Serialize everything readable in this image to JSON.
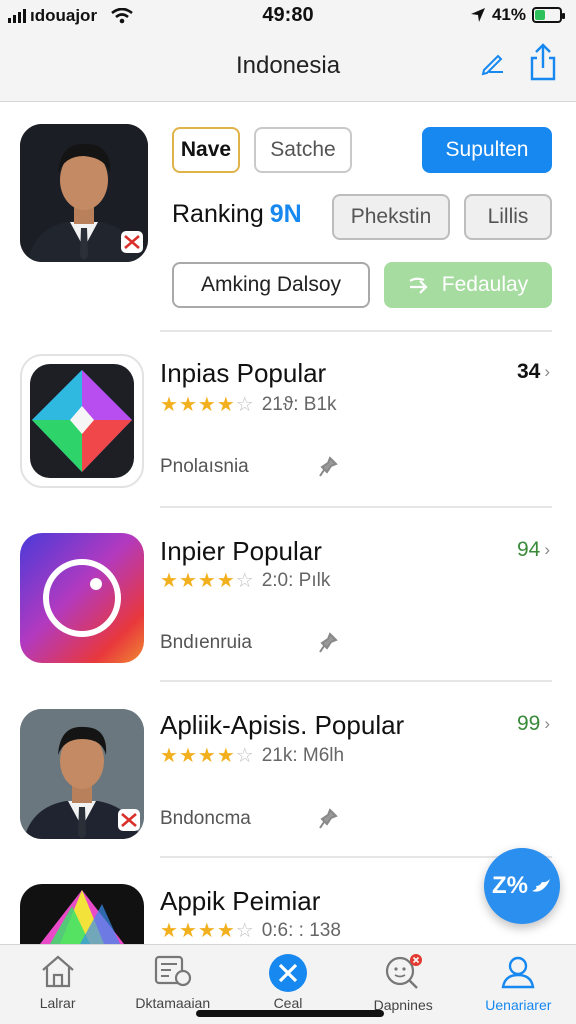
{
  "status_bar": {
    "carrier": "ıdouajor",
    "time": "49:80",
    "battery_percent": "41%",
    "battery_level": 0.41
  },
  "nav": {
    "title": "Indonesia",
    "edit_icon": "pencil-icon",
    "share_icon": "share-icon"
  },
  "header": {
    "chips": {
      "nave": "Nave",
      "satche": "Satche",
      "supulten": "Supulten"
    },
    "ranking_label": "Ranking",
    "ranking_value": "9N",
    "buttons": {
      "phekstin": "Phekstin",
      "lillis": "Lillis",
      "amking": "Amking Dalsoy",
      "fedaulay": "Fedaulay"
    }
  },
  "apps": [
    {
      "title": "Inpias Popular",
      "rating": 4.5,
      "meta": "21ϑ: Β1k",
      "subtitle": "Pnolaısnia",
      "count": "34",
      "count_color": "#111111"
    },
    {
      "title": "Inpier Popular",
      "rating": 4.5,
      "meta": "2:0: Pılk",
      "subtitle": "Bndıenruia",
      "count": "94",
      "count_color": "#3a8a3a"
    },
    {
      "title": "Apliik-Apisis. Popular",
      "rating": 4.5,
      "meta": "21k: M6lh",
      "subtitle": "Bndoncma",
      "count": "99",
      "count_color": "#3a8a3a"
    },
    {
      "title": "Appik Peimiar",
      "rating": 4.5,
      "meta": "0:6: : 138",
      "subtitle": "",
      "count": "",
      "count_color": "#111111"
    }
  ],
  "fab": {
    "label": "Z%"
  },
  "tabs": [
    {
      "label": "Lalrar",
      "icon": "home-icon"
    },
    {
      "label": "Dktamaaian",
      "icon": "gallery-icon"
    },
    {
      "label": "Ceal",
      "icon": "close-circle-icon"
    },
    {
      "label": "Dapnines",
      "icon": "search-face-icon"
    },
    {
      "label": "Uenariarer",
      "icon": "profile-icon"
    }
  ],
  "colors": {
    "accent": "#1688f0",
    "star": "#f2b01e",
    "green_button": "#a6dca0",
    "selected_border": "#e0b24a"
  }
}
